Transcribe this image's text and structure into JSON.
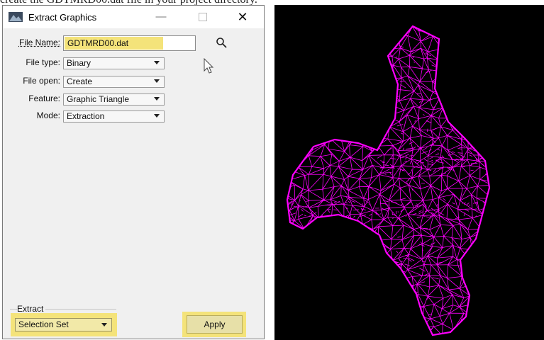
{
  "top_text": "create the GDTMRD00.dat file in your project directory.",
  "dialog": {
    "title": "Extract Graphics",
    "minimize_label": "—",
    "close_label": "✕",
    "file_name_label": "File Name:",
    "file_name_value": "GDTMRD00.dat",
    "fields": [
      {
        "label": "File type:",
        "value": "Binary"
      },
      {
        "label": "File open:",
        "value": "Create"
      },
      {
        "label": "Feature:",
        "value": "Graphic Triangle"
      },
      {
        "label": "Mode:",
        "value": "Extraction"
      }
    ],
    "extract_group_label": "Extract",
    "extract_select_value": "Selection Set",
    "apply_label": "Apply"
  },
  "colors": {
    "highlight": "#f4e37a",
    "mesh": "#ff00ff",
    "viewport_bg": "#000000"
  },
  "icons": [
    "app-icon",
    "search-icon",
    "cursor-icon",
    "chevron-down-icon"
  ]
}
